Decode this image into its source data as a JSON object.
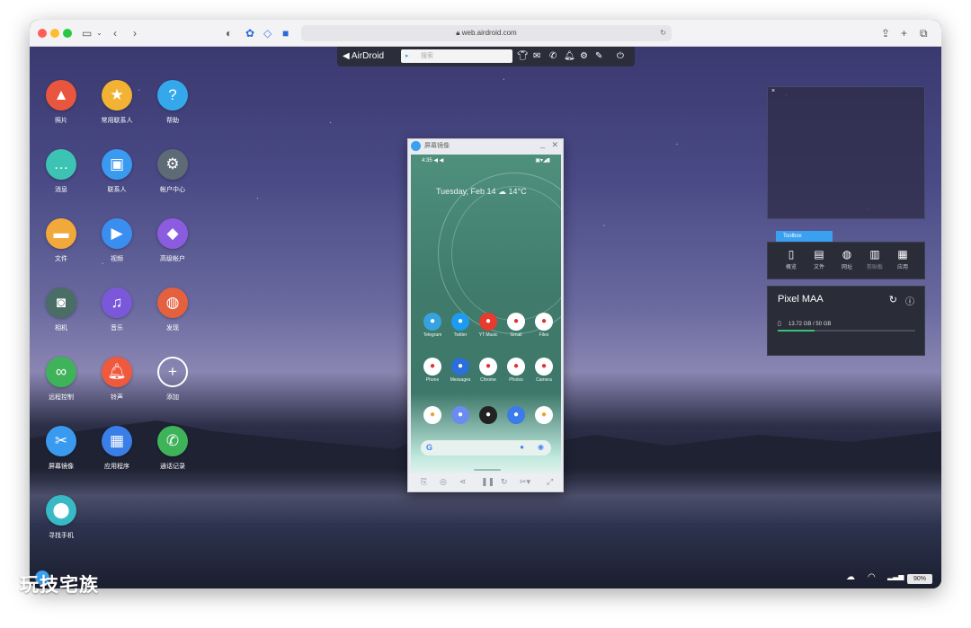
{
  "browser": {
    "url": "web.airdroid.com",
    "traffic_colors": [
      "#ff5f57",
      "#febc2e",
      "#28c840"
    ]
  },
  "toolbar": {
    "logo": "AirDroid",
    "search_placeholder": "搜索"
  },
  "desktop_icons": [
    {
      "label": "照片",
      "icon": "photo-icon",
      "color": "#e9563f"
    },
    {
      "label": "常用联系人",
      "icon": "star-contact-icon",
      "color": "#f2b233"
    },
    {
      "label": "帮助",
      "icon": "help-icon",
      "color": "#35a8ec"
    },
    {
      "label": "消息",
      "icon": "message-icon",
      "color": "#3cc3b3"
    },
    {
      "label": "联系人",
      "icon": "contacts-icon",
      "color": "#3a9af0"
    },
    {
      "label": "帐户中心",
      "icon": "gear-icon",
      "color": "#5e6b77"
    },
    {
      "label": "文件",
      "icon": "folder-icon",
      "color": "#f2a93b"
    },
    {
      "label": "视频",
      "icon": "video-icon",
      "color": "#3a8ef0"
    },
    {
      "label": "高级帐户",
      "icon": "diamond-icon",
      "color": "#8b5ce0"
    },
    {
      "label": "相机",
      "icon": "camera-icon",
      "color": "#4a6e66"
    },
    {
      "label": "音乐",
      "icon": "music-icon",
      "color": "#7a58d9"
    },
    {
      "label": "发现",
      "icon": "planet-icon",
      "color": "#e5603f"
    },
    {
      "label": "远程控制",
      "icon": "binoculars-icon",
      "color": "#3fb35a"
    },
    {
      "label": "铃声",
      "icon": "bell-icon",
      "color": "#ef5a3e"
    },
    {
      "label": "添加",
      "icon": "add-icon",
      "color": "transparent"
    },
    {
      "label": "屏幕镜像",
      "icon": "scissors-icon",
      "color": "#3a9af0"
    },
    {
      "label": "应用程序",
      "icon": "apps-icon",
      "color": "#3a7ee8"
    },
    {
      "label": "通话记录",
      "icon": "phone-icon",
      "color": "#3fb35a"
    },
    {
      "label": "寻找手机",
      "icon": "location-icon",
      "color": "#38b9c6"
    }
  ],
  "mirror": {
    "title": "屏幕镜像",
    "status_time": "4:35",
    "date_weather": "Tuesday, Feb 14 ☁ 14°C",
    "apps": [
      {
        "label": "Telegram",
        "color": "#36a3e0"
      },
      {
        "label": "Twitter",
        "color": "#1d9bf0"
      },
      {
        "label": "YT Music",
        "color": "#e63b2e"
      },
      {
        "label": "Gmail",
        "color": "#ffffff"
      },
      {
        "label": "Files",
        "color": "#ffffff"
      },
      {
        "label": "Phone",
        "color": "#ffffff"
      },
      {
        "label": "Messages",
        "color": "#2b6fd8"
      },
      {
        "label": "Chrome",
        "color": "#ffffff"
      },
      {
        "label": "Photos",
        "color": "#ffffff"
      },
      {
        "label": "Camera",
        "color": "#ffffff"
      }
    ],
    "dock_colors": [
      "#ffffff",
      "#6a8cf0",
      "#222222",
      "#3b7bea",
      "#ffffff"
    ]
  },
  "toolbox": {
    "tab": "Toolbox",
    "items": [
      {
        "label": "概览",
        "icon": "phone-outline-icon"
      },
      {
        "label": "文件",
        "icon": "document-icon"
      },
      {
        "label": "网址",
        "icon": "globe-icon"
      },
      {
        "label": "剪贴板",
        "icon": "clipboard-icon"
      },
      {
        "label": "应用",
        "icon": "apps-icon"
      }
    ]
  },
  "device": {
    "name": "Pixel MAA",
    "storage": "13.72 GB / 50 GB",
    "storage_fraction": 0.27
  },
  "status": {
    "battery": "90%"
  },
  "watermark": "玩技宅族"
}
